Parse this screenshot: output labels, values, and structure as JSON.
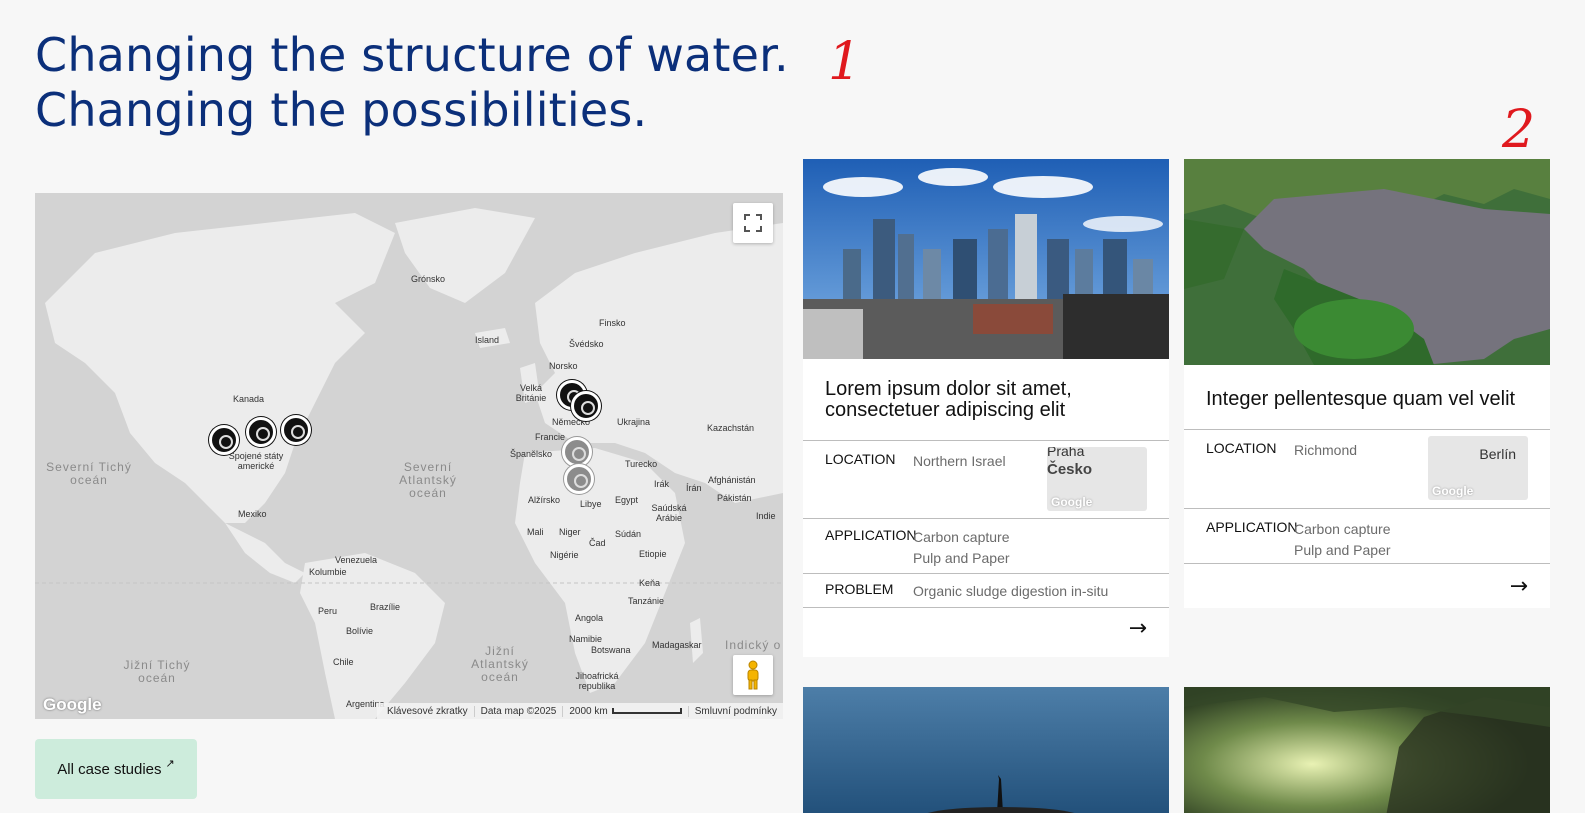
{
  "headline": {
    "line1": "Changing the structure of water.",
    "line2": "Changing the possibilities."
  },
  "annotations": [
    "1",
    "2"
  ],
  "map": {
    "labels": {
      "gronsko": "Grónsko",
      "island": "Island",
      "finsko": "Finsko",
      "svedsko": "Švédsko",
      "norsko": "Norsko",
      "velka_britanie": "Velká Británie",
      "nemecko": "Německo",
      "ukrajina": "Ukrajina",
      "francie": "Francie",
      "spanelsko": "Španělsko",
      "turecko": "Turecko",
      "kazachstan": "Kazachstán",
      "kanada": "Kanada",
      "usa": "Spojené státy americké",
      "mexiko": "Mexiko",
      "irak": "Irák",
      "iran": "Írán",
      "afghanistan": "Afghánistán",
      "pakistan": "Pákistán",
      "alzirsko": "Alžírsko",
      "libye": "Libye",
      "egypt": "Egypt",
      "saudska_arabie": "Saúdská Arábie",
      "indie": "Indie",
      "mali": "Mali",
      "niger": "Niger",
      "cad": "Čad",
      "sudan": "Súdán",
      "nigerie": "Nigérie",
      "etiopie": "Etiopie",
      "kena": "Keňa",
      "tanzanie": "Tanzánie",
      "venezuela": "Venezuela",
      "kolumbie": "Kolumbie",
      "peru": "Peru",
      "brazilie": "Brazílie",
      "bolivie": "Bolívie",
      "chile": "Chile",
      "angola": "Angola",
      "namibie": "Namibie",
      "botswana": "Botswana",
      "madagaskar": "Madagaskar",
      "jihoafricka": "Jihoafrická republika",
      "argentina": "Argentina"
    },
    "oceans": {
      "north_pacific": "Severní Tichý oceán",
      "north_atlantic": "Severní Atlantský oceán",
      "south_pacific": "Jižní Tichý oceán",
      "south_atlantic": "Jižní Atlantský oceán",
      "indian": "Indický o"
    },
    "google_logo": "Google",
    "footer": {
      "shortcuts": "Klávesové zkratky",
      "data": "Data map ©2025",
      "scale": "2000 km",
      "terms": "Smluvní podmínky"
    },
    "fullscreen_icon": "fullscreen-icon",
    "pegman_icon": "pegman-icon"
  },
  "all_case_studies": {
    "label": "All case studies",
    "icon": "↗"
  },
  "cards": [
    {
      "title": "Lorem ipsum dolor sit amet, consectetuer adipiscing elit",
      "rows": [
        {
          "key": "LOCATION",
          "value": "Northern Israel"
        },
        {
          "key": "APPLICATION",
          "value1": "Carbon capture",
          "value2": "Pulp and Paper"
        },
        {
          "key": "PROBLEM",
          "value": "Organic sludge digestion in-situ"
        }
      ],
      "minimap_label1": "Praha",
      "minimap_label2": "Česko",
      "minimap_google": "Google",
      "arrow": "→"
    },
    {
      "title": "Integer pellentesque quam vel velit",
      "rows": [
        {
          "key": "LOCATION",
          "value": "Richmond"
        },
        {
          "key": "APPLICATION",
          "value1": "Carbon capture",
          "value2": "Pulp and Paper"
        }
      ],
      "minimap_label1": "Berlín",
      "minimap_google": "Google",
      "arrow": "→"
    }
  ],
  "colors": {
    "headline": "#0b2f7a",
    "annotation": "#e0191e",
    "button_bg": "#cdecdc",
    "page_bg": "#f7f7f7"
  }
}
